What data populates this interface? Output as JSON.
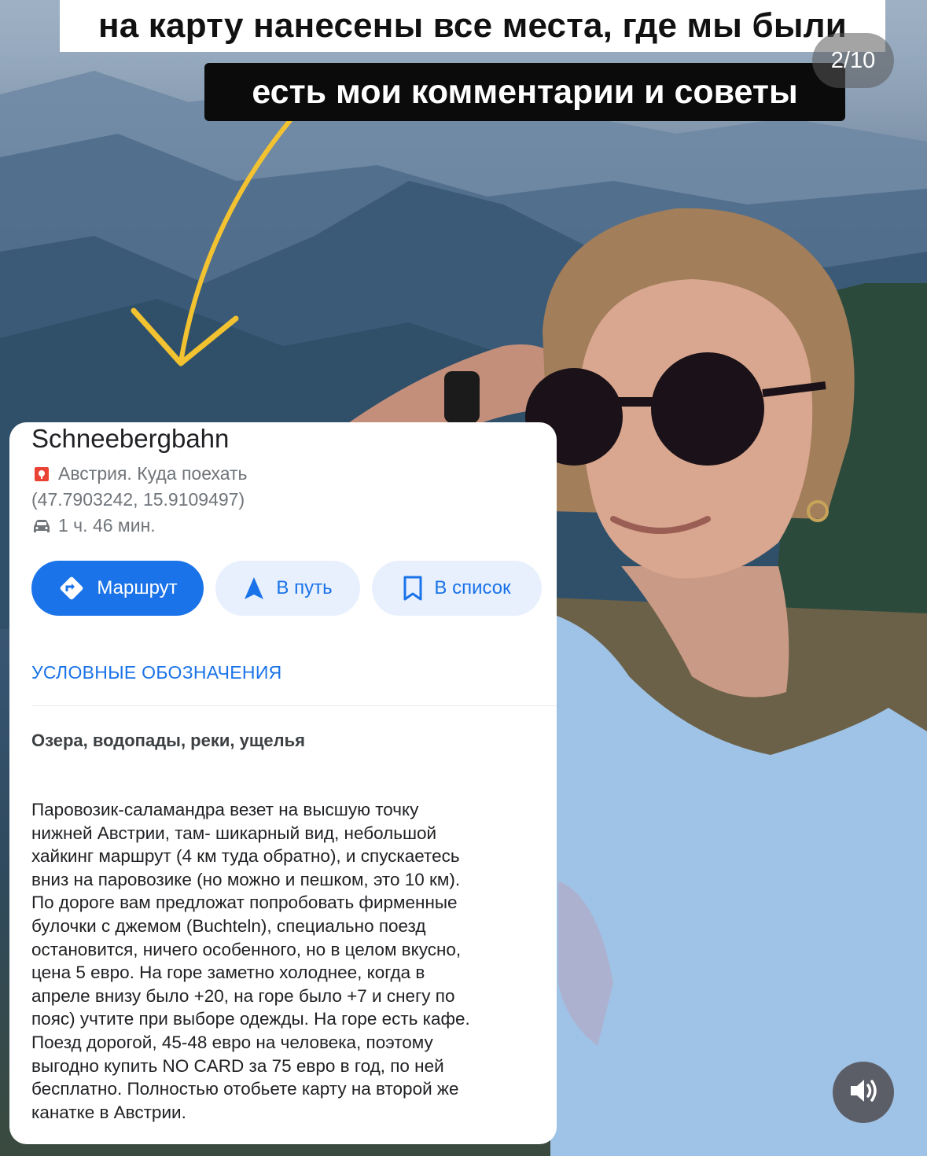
{
  "overlay": {
    "caption_top": "на карту нанесены все места, где мы были",
    "caption_bottom": "есть мои комментарии и советы",
    "story_counter": "2/10",
    "sound_icon": "speaker-icon"
  },
  "place_card": {
    "title": "Schneebergbahn",
    "list_icon": "map-pin-icon",
    "list_name": "Австрия. Куда поехать",
    "coordinates": "(47.7903242, 15.9109497)",
    "travel_icon": "car-icon",
    "travel_time": "1 ч. 46 мин.",
    "buttons": {
      "route": "Маршрут",
      "start": "В путь",
      "save": "В список"
    },
    "legend_label": "УСЛОВНЫЕ ОБОЗНАЧЕНИЯ",
    "category": "Озера, водопады, реки, ущелья",
    "description": "Паровозик-саламандра везет на высшую точку\nнижней Австрии, там- шикарный вид, небольшой\nхайкинг маршрут (4 км туда обратно), и спускаетесь\nвниз на паровозике (но можно и пешком, это 10 км).\nПо дороге вам предложат попробовать фирменные\nбулочки с джемом (Buchteln), специально поезд\nостановится, ничего особенного, но в целом вкусно,\nцена 5 евро. На горе заметно холоднее, когда в\nапреле внизу было +20, на горе было +7 и снегу по\nпояс) учтите при выборе одежды. На горе есть кафе.\nПоезд дорогой, 45-48 евро на человека, поэтому\nвыгодно купить NO CARD  за 75 евро в год, по ней\nбесплатно. Полностью отобьете карту на второй же\nканатке в Австрии."
  },
  "colors": {
    "accent": "#1a73e8",
    "accent_light": "#e8f0fe",
    "arrow": "#f2c230",
    "pin": "#ea4335"
  }
}
